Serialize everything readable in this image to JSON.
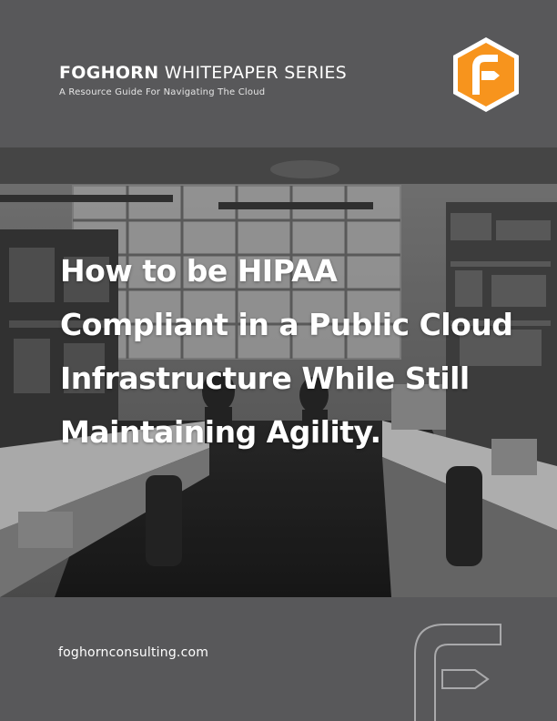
{
  "header": {
    "brand": "FOGHORN",
    "series": "WHITEPAPER SERIES",
    "tagline": "A Resource Guide For Navigating The Cloud"
  },
  "headline": {
    "line1": "How to be HIPAA",
    "line2": "Compliant in a Public Cloud",
    "line3": "Infrastructure While Still",
    "line4": "Maintaining Agility."
  },
  "footer": {
    "website": "foghornconsulting.com"
  },
  "colors": {
    "background": "#58585a",
    "accent_orange": "#f7941d",
    "text": "#ffffff"
  },
  "icons": {
    "logo": "foghorn-f-logo-icon",
    "outline_logo": "foghorn-f-outline-icon"
  }
}
